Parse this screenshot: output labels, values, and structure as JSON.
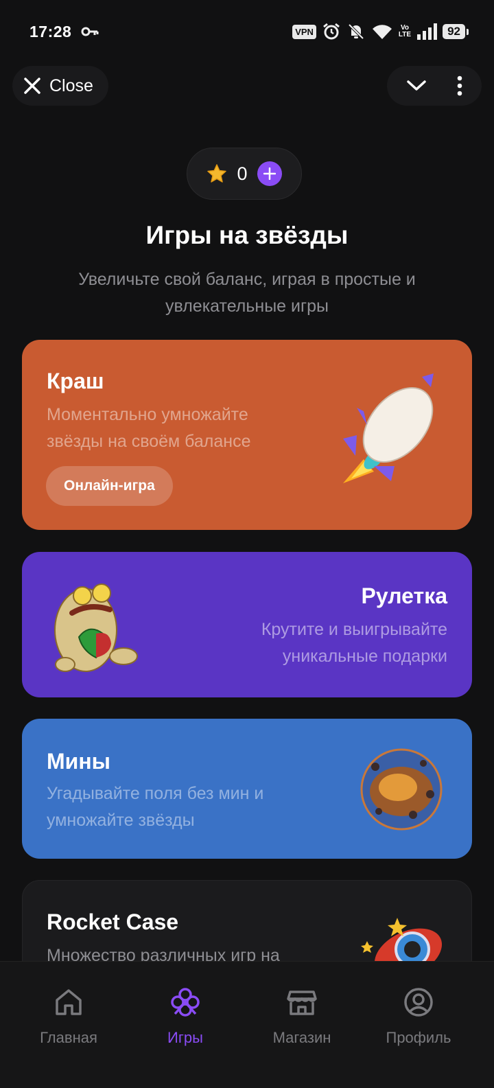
{
  "status_bar": {
    "time": "17:28",
    "vpn": "VPN",
    "volte_top": "Vo",
    "volte_bottom": "LTE",
    "battery": "92",
    "icons": [
      "key-icon",
      "alarm-icon",
      "bell-off-icon",
      "wifi-icon",
      "signal-icon"
    ]
  },
  "top_bar": {
    "close_label": "Close",
    "icons": [
      "close-icon",
      "chevron-down-icon",
      "more-vertical-icon"
    ]
  },
  "balance": {
    "value": "0",
    "icon": "star-icon",
    "add_icon": "plus-icon"
  },
  "header": {
    "title": "Игры на звёзды",
    "subtitle": "Увеличьте свой баланс, играя в простые и увлекательные игры"
  },
  "games": [
    {
      "title": "Краш",
      "description": "Моментально умножайте звёзды на своём балансе",
      "tag": "Онлайн-игра",
      "color": "#c95b31",
      "image": "rocket-sticker"
    },
    {
      "title": "Рулетка",
      "description": "Крутите и выигрывайте уникальные подарки",
      "color": "#5a35c4",
      "image": "frog-sticker"
    },
    {
      "title": "Мины",
      "description": "Угадывайте поля без мин и умножайте звёзды",
      "color": "#3a72c6",
      "image": "bomb-sticker"
    },
    {
      "title": "Rocket Case",
      "description": "Множество различных игр на",
      "color": "#1b1b1d",
      "image": "rocket-case-sticker"
    }
  ],
  "nav": [
    {
      "label": "Главная",
      "icon": "home-icon",
      "active": false
    },
    {
      "label": "Игры",
      "icon": "clover-icon",
      "active": true
    },
    {
      "label": "Магазин",
      "icon": "store-icon",
      "active": false
    },
    {
      "label": "Профиль",
      "icon": "profile-icon",
      "active": false
    }
  ],
  "colors": {
    "accent": "#8a4cf5",
    "background": "#111112"
  }
}
